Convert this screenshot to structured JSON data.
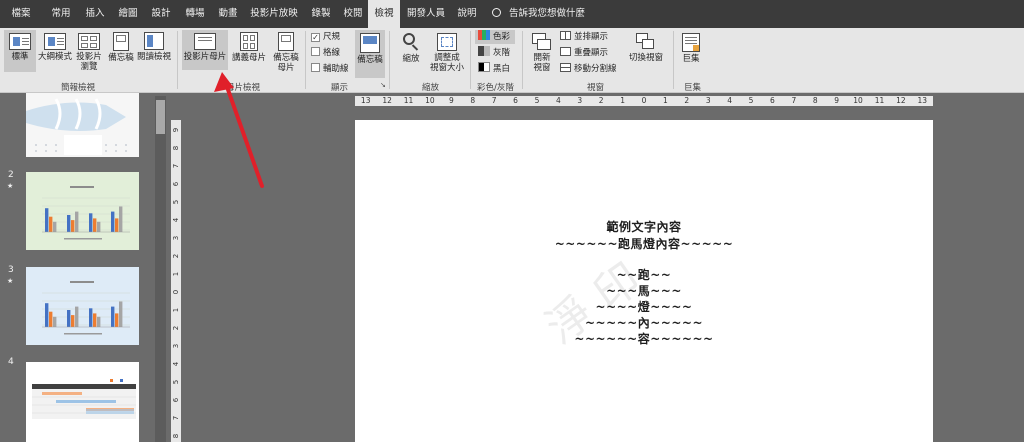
{
  "tabs": [
    {
      "label": "檔案",
      "active": false
    },
    {
      "label": "常用",
      "active": false
    },
    {
      "label": "插入",
      "active": false
    },
    {
      "label": "繪圖",
      "active": false
    },
    {
      "label": "設計",
      "active": false
    },
    {
      "label": "轉場",
      "active": false
    },
    {
      "label": "動畫",
      "active": false
    },
    {
      "label": "投影片放映",
      "active": false
    },
    {
      "label": "錄製",
      "active": false
    },
    {
      "label": "校閱",
      "active": false
    },
    {
      "label": "檢視",
      "active": true
    },
    {
      "label": "開發人員",
      "active": false
    },
    {
      "label": "說明",
      "active": false
    }
  ],
  "tellme": "告訴我您想做什麼",
  "ribbon": {
    "presentation_views": {
      "normal": "標準",
      "outline": "大綱模式",
      "sorter_line1": "投影片",
      "sorter_line2": "瀏覽",
      "notes_page": "備忘稿",
      "reading": "閱讀檢視",
      "group": "簡報檢視"
    },
    "master_views": {
      "slide_master": "投影片母片",
      "handout_master": "講義母片",
      "notes_master_line1": "備忘稿",
      "notes_master_line2": "母片",
      "group": "母片檢視"
    },
    "show": {
      "ruler": "尺規",
      "ruler_checked": true,
      "gridlines": "格線",
      "gridlines_checked": false,
      "guides": "輔助線",
      "guides_checked": false,
      "notes": "備忘稿",
      "group": "顯示",
      "launcher": "↘"
    },
    "zoom": {
      "zoom": "縮放",
      "fit_line1": "調整成",
      "fit_line2": "視窗大小",
      "group": "縮放"
    },
    "color": {
      "color": "色彩",
      "grayscale": "灰階",
      "bw": "黑白",
      "group": "彩色/灰階"
    },
    "window": {
      "new_line1": "開新",
      "new_line2": "視窗",
      "arrange": "並排顯示",
      "cascade": "重疊顯示",
      "move_split": "移動分割線",
      "switch": "切換視窗",
      "group": "視窗"
    },
    "macros": {
      "macros": "巨集",
      "group": "巨集"
    }
  },
  "thumbnails": [
    {
      "number": "",
      "starred": false
    },
    {
      "number": "2",
      "starred": true,
      "star": "★",
      "bg": "#e2efd9"
    },
    {
      "number": "3",
      "starred": true,
      "star": "★",
      "bg": "#deebf7"
    },
    {
      "number": "4",
      "starred": false
    }
  ],
  "hruler_ticks": [
    "13",
    "12",
    "11",
    "10",
    "9",
    "8",
    "7",
    "6",
    "5",
    "4",
    "3",
    "2",
    "1",
    "0",
    "1",
    "2",
    "3",
    "4",
    "5",
    "6",
    "7",
    "8",
    "9",
    "10",
    "11",
    "12",
    "13"
  ],
  "vruler_ticks": [
    "9",
    "8",
    "7",
    "6",
    "5",
    "4",
    "3",
    "2",
    "1",
    "0",
    "1",
    "2",
    "3",
    "4",
    "5",
    "6",
    "7",
    "8"
  ],
  "slide": {
    "title": "範例文字內容",
    "subtitle": "~~~~~~跑馬燈內容~~~~~",
    "lines": [
      "~~跑~~",
      "~~~馬~~~",
      "~~~~燈~~~~",
      "~~~~~內~~~~~",
      "~~~~~~容~~~~~~"
    ]
  },
  "colors": {
    "tabbar": "#3b3b3b",
    "ribbon": "#e6e6e6",
    "workspace": "#6b6b6b",
    "arrow": "#e0202a",
    "bar_blue": "#4472c4",
    "bar_orange": "#ed7d31",
    "bar_gray": "#a5a5a5"
  }
}
